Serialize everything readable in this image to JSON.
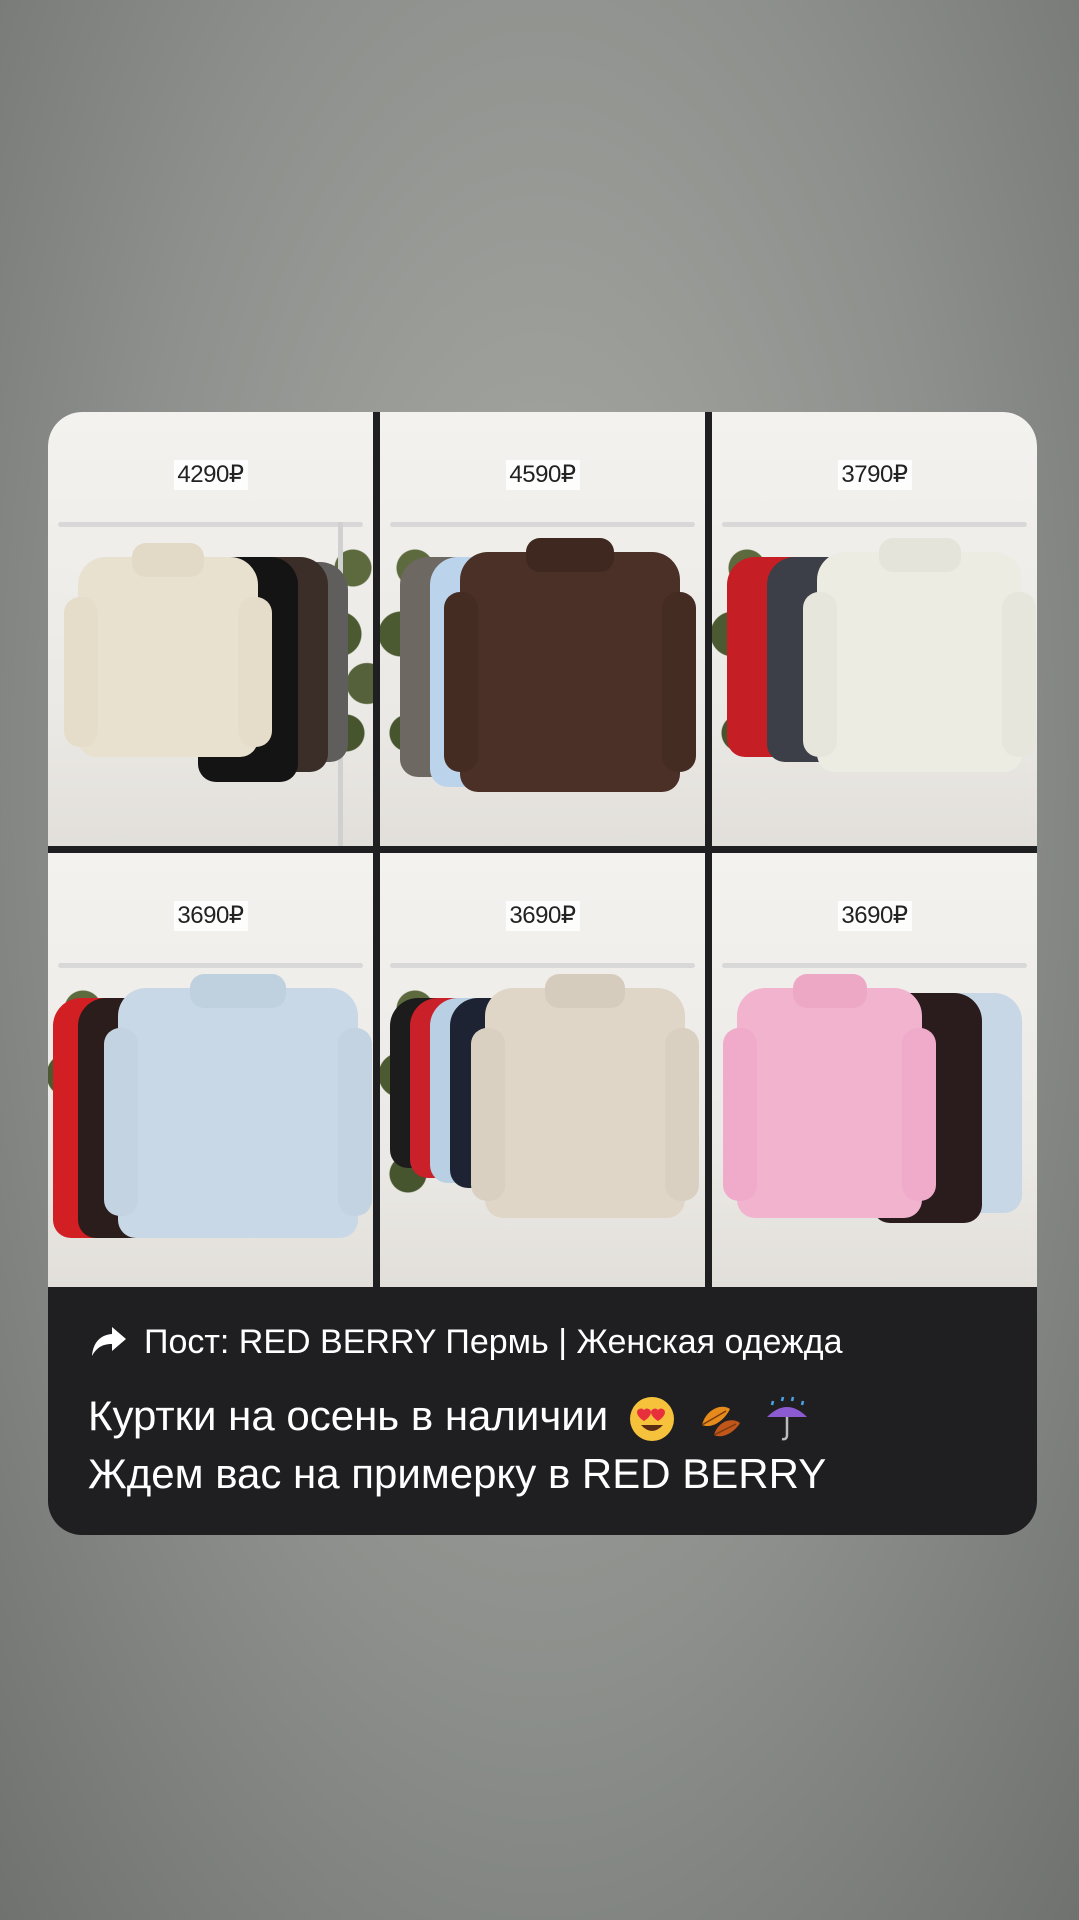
{
  "post": {
    "icon": "share-arrow-icon",
    "label": "Пост: RED BERRY Пермь | Женская одежда"
  },
  "caption": {
    "line1": "Куртки на осень в наличии",
    "line2": "Ждем вас на примерку в RED BERRY",
    "emojis": [
      "heart-eyes-emoji",
      "falling-leaf-emoji",
      "umbrella-rain-emoji"
    ]
  },
  "tiles": [
    {
      "price": "4290₽"
    },
    {
      "price": "4590₽"
    },
    {
      "price": "3790₽"
    },
    {
      "price": "3690₽"
    },
    {
      "price": "3690₽"
    },
    {
      "price": "3690₽"
    }
  ],
  "colors": {
    "card_bg": "#1f1f21",
    "text": "#ffffff"
  }
}
